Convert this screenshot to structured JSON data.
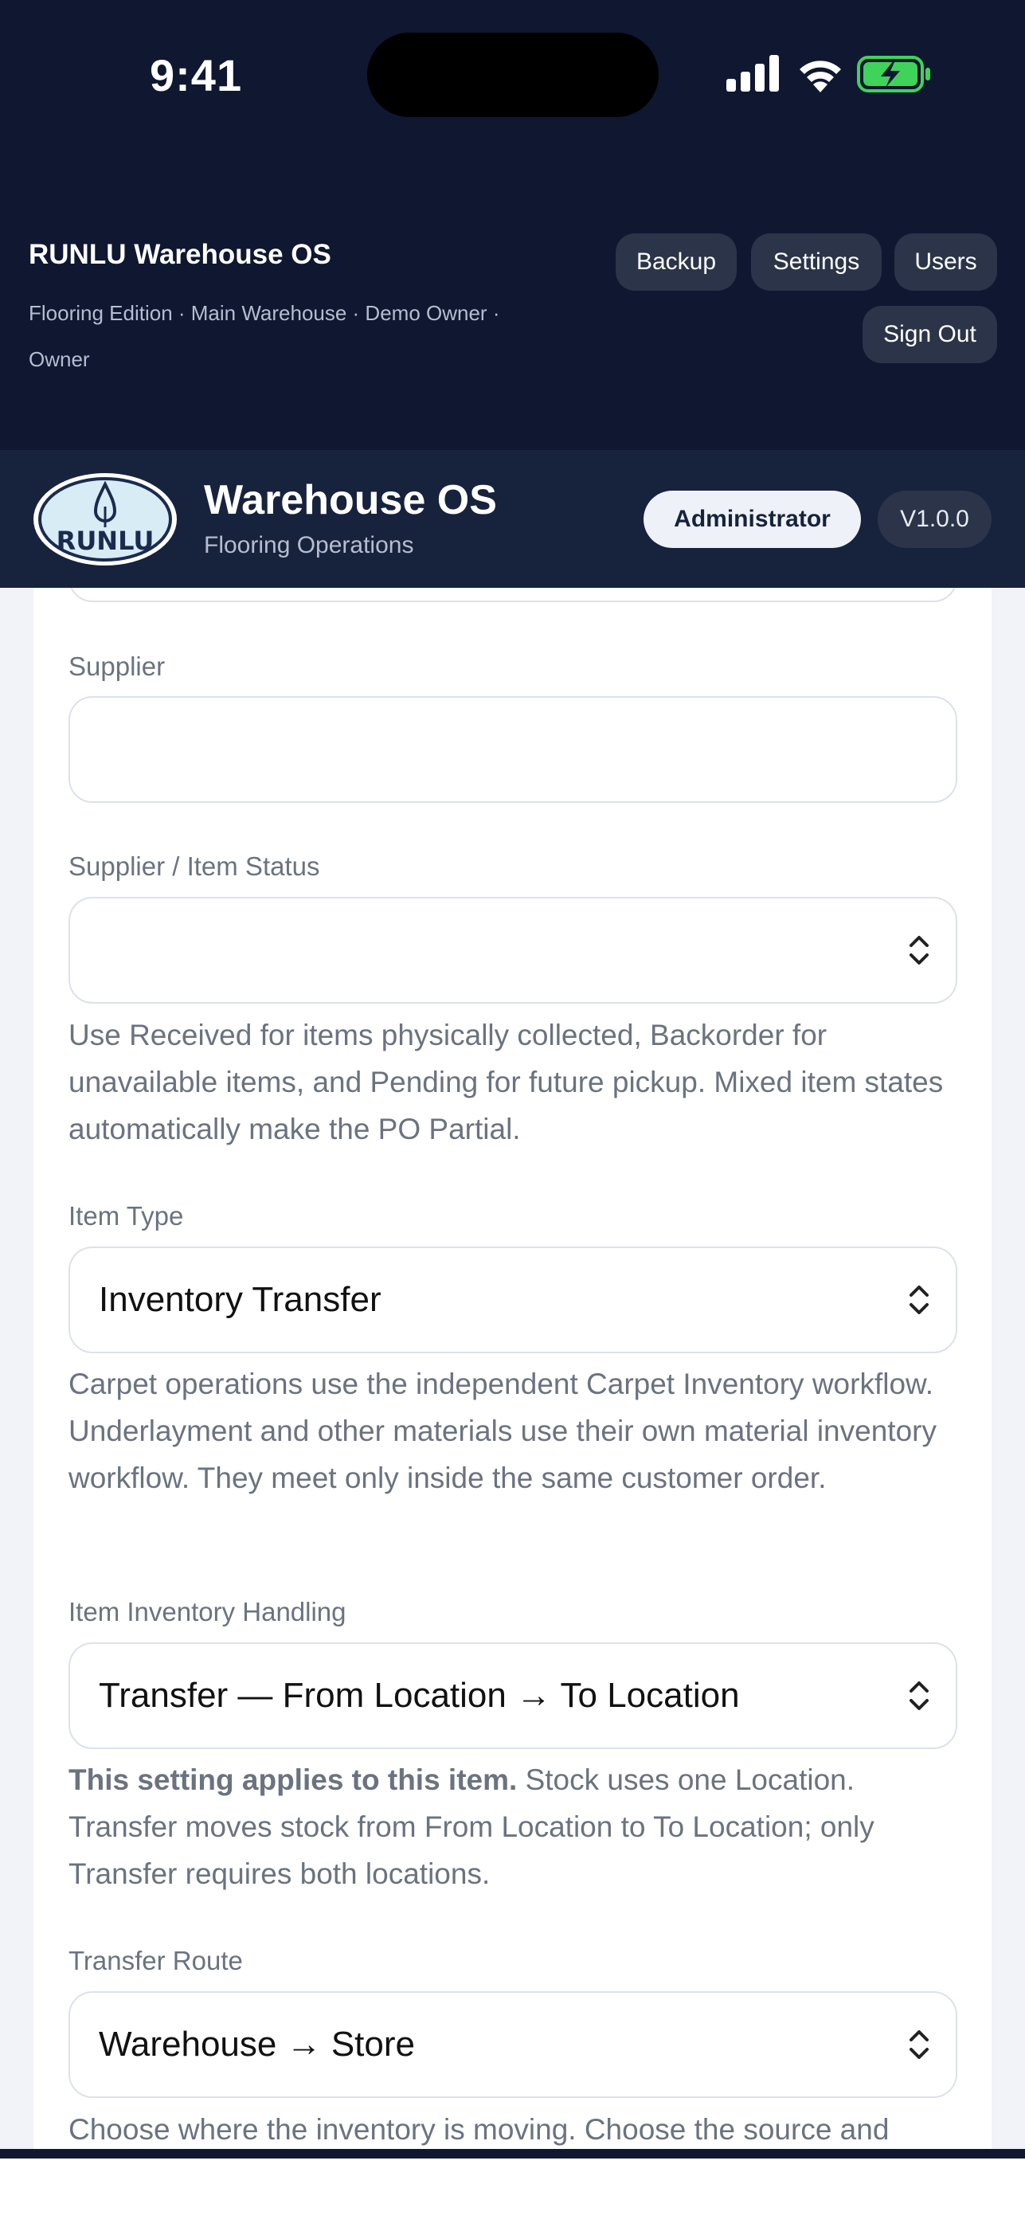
{
  "status_bar": {
    "time": "9:41"
  },
  "header": {
    "app_title": "RUNLU Warehouse OS",
    "subtitle": "Flooring Edition · Main Warehouse · Demo Owner · Owner",
    "buttons": {
      "backup": "Backup",
      "settings": "Settings",
      "users": "Users",
      "sign_out": "Sign Out"
    }
  },
  "brand_bar": {
    "logo_text": "RUNLU",
    "title": "Warehouse OS",
    "subtitle": "Flooring Operations",
    "role_badge": "Administrator",
    "version_badge": "V1.0.0"
  },
  "form": {
    "supplier": {
      "label": "Supplier",
      "value": ""
    },
    "supplier_status": {
      "label": "Supplier / Item Status",
      "value": "",
      "help": "Use Received for items physically collected, Backorder for unavailable items, and Pending for future pickup. Mixed item states automatically make the PO Partial."
    },
    "item_type": {
      "label": "Item Type",
      "value": "Inventory Transfer",
      "help": "Carpet operations use the independent Carpet Inventory workflow. Underlayment and other materials use their own material inventory workflow. They meet only inside the same customer order."
    },
    "inventory_handling": {
      "label": "Item Inventory Handling",
      "value": "Transfer — From Location → To Location",
      "help_bold": "This setting applies to this item.",
      "help": " Stock uses one Location. Transfer moves stock from From Location to To Location; only Transfer requires both locations."
    },
    "transfer_route": {
      "label": "Transfer Route",
      "value": "Warehouse → Store",
      "help": "Choose where the inventory is moving. Choose the source and"
    }
  },
  "colors": {
    "header_bg": "#0f1731",
    "brand_bar_bg": "#17223d",
    "header_button_bg": "#2b3448",
    "battery_green": "#3fd35a",
    "page_bg": "#f1f3f8"
  }
}
